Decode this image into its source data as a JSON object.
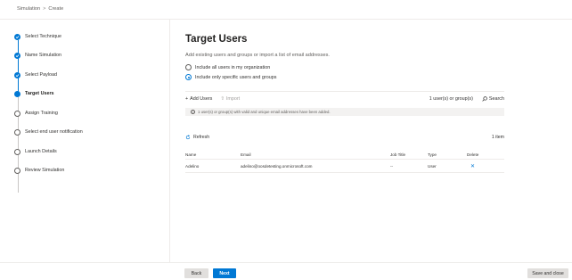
{
  "breadcrumb": {
    "root": "Simulation",
    "separator": ">",
    "current": "Create"
  },
  "wizard": {
    "steps": [
      {
        "label": "Select Technique",
        "state": "done"
      },
      {
        "label": "Name Simulation",
        "state": "done"
      },
      {
        "label": "Select Payload",
        "state": "done"
      },
      {
        "label": "Target Users",
        "state": "current"
      },
      {
        "label": "Assign Training",
        "state": "pending"
      },
      {
        "label": "Select end user notification",
        "state": "pending"
      },
      {
        "label": "Launch Details",
        "state": "pending"
      },
      {
        "label": "Review Simulation",
        "state": "pending"
      }
    ]
  },
  "main": {
    "title": "Target Users",
    "subtitle": "Add existing users and groups or import a list of email addresses.",
    "radio_all": "Include all users in my organization",
    "radio_specific": "Include only specific users and groups",
    "selected_option": "specific"
  },
  "toolbar": {
    "add_users": "Add Users",
    "import": "Import",
    "count_label": "1 user(s) or group(s)",
    "search": "Search"
  },
  "info": {
    "message": "1 user(s) or group(s) with valid and unique email addresses have been added."
  },
  "list": {
    "refresh": "Refresh",
    "item_count": "1 item",
    "headers": {
      "name": "Name",
      "email": "Email",
      "job_title": "Job Title",
      "type": "Type",
      "delete": "Delete"
    },
    "rows": [
      {
        "name": "Adelino",
        "email": "adelino@oosdetesting.onmicrosoft.com",
        "job_title": "--",
        "type": "User"
      }
    ]
  },
  "footer": {
    "back": "Back",
    "next": "Next",
    "save_close": "Save and close"
  },
  "colors": {
    "accent": "#0078d4",
    "background": "#faf9f8"
  }
}
